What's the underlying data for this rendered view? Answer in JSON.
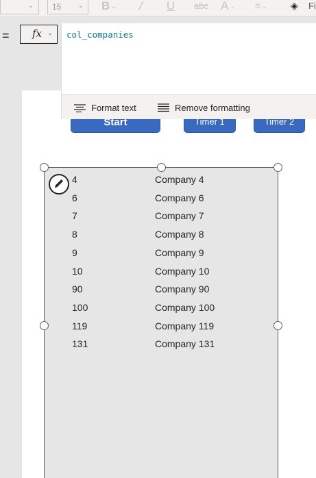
{
  "ribbon": {
    "font_size_value": "15",
    "fill_label": "Fi"
  },
  "formula_bar": {
    "equals": "=",
    "fx_label": "fx",
    "formula": "col_companies",
    "format_text_label": "Format text",
    "remove_formatting_label": "Remove formatting"
  },
  "canvas": {
    "buttons": [
      {
        "label": "Start"
      },
      {
        "label": "Timer 1"
      },
      {
        "label": "Timer 2"
      }
    ],
    "gallery_rows": [
      {
        "id": "4",
        "name": "Company 4"
      },
      {
        "id": "6",
        "name": "Company 6"
      },
      {
        "id": "7",
        "name": "Company 7"
      },
      {
        "id": "8",
        "name": "Company 8"
      },
      {
        "id": "9",
        "name": "Company 9"
      },
      {
        "id": "10",
        "name": "Company 10"
      },
      {
        "id": "90",
        "name": "Company 90"
      },
      {
        "id": "100",
        "name": "Company 100"
      },
      {
        "id": "119",
        "name": "Company 119"
      },
      {
        "id": "131",
        "name": "Company 131"
      }
    ]
  }
}
